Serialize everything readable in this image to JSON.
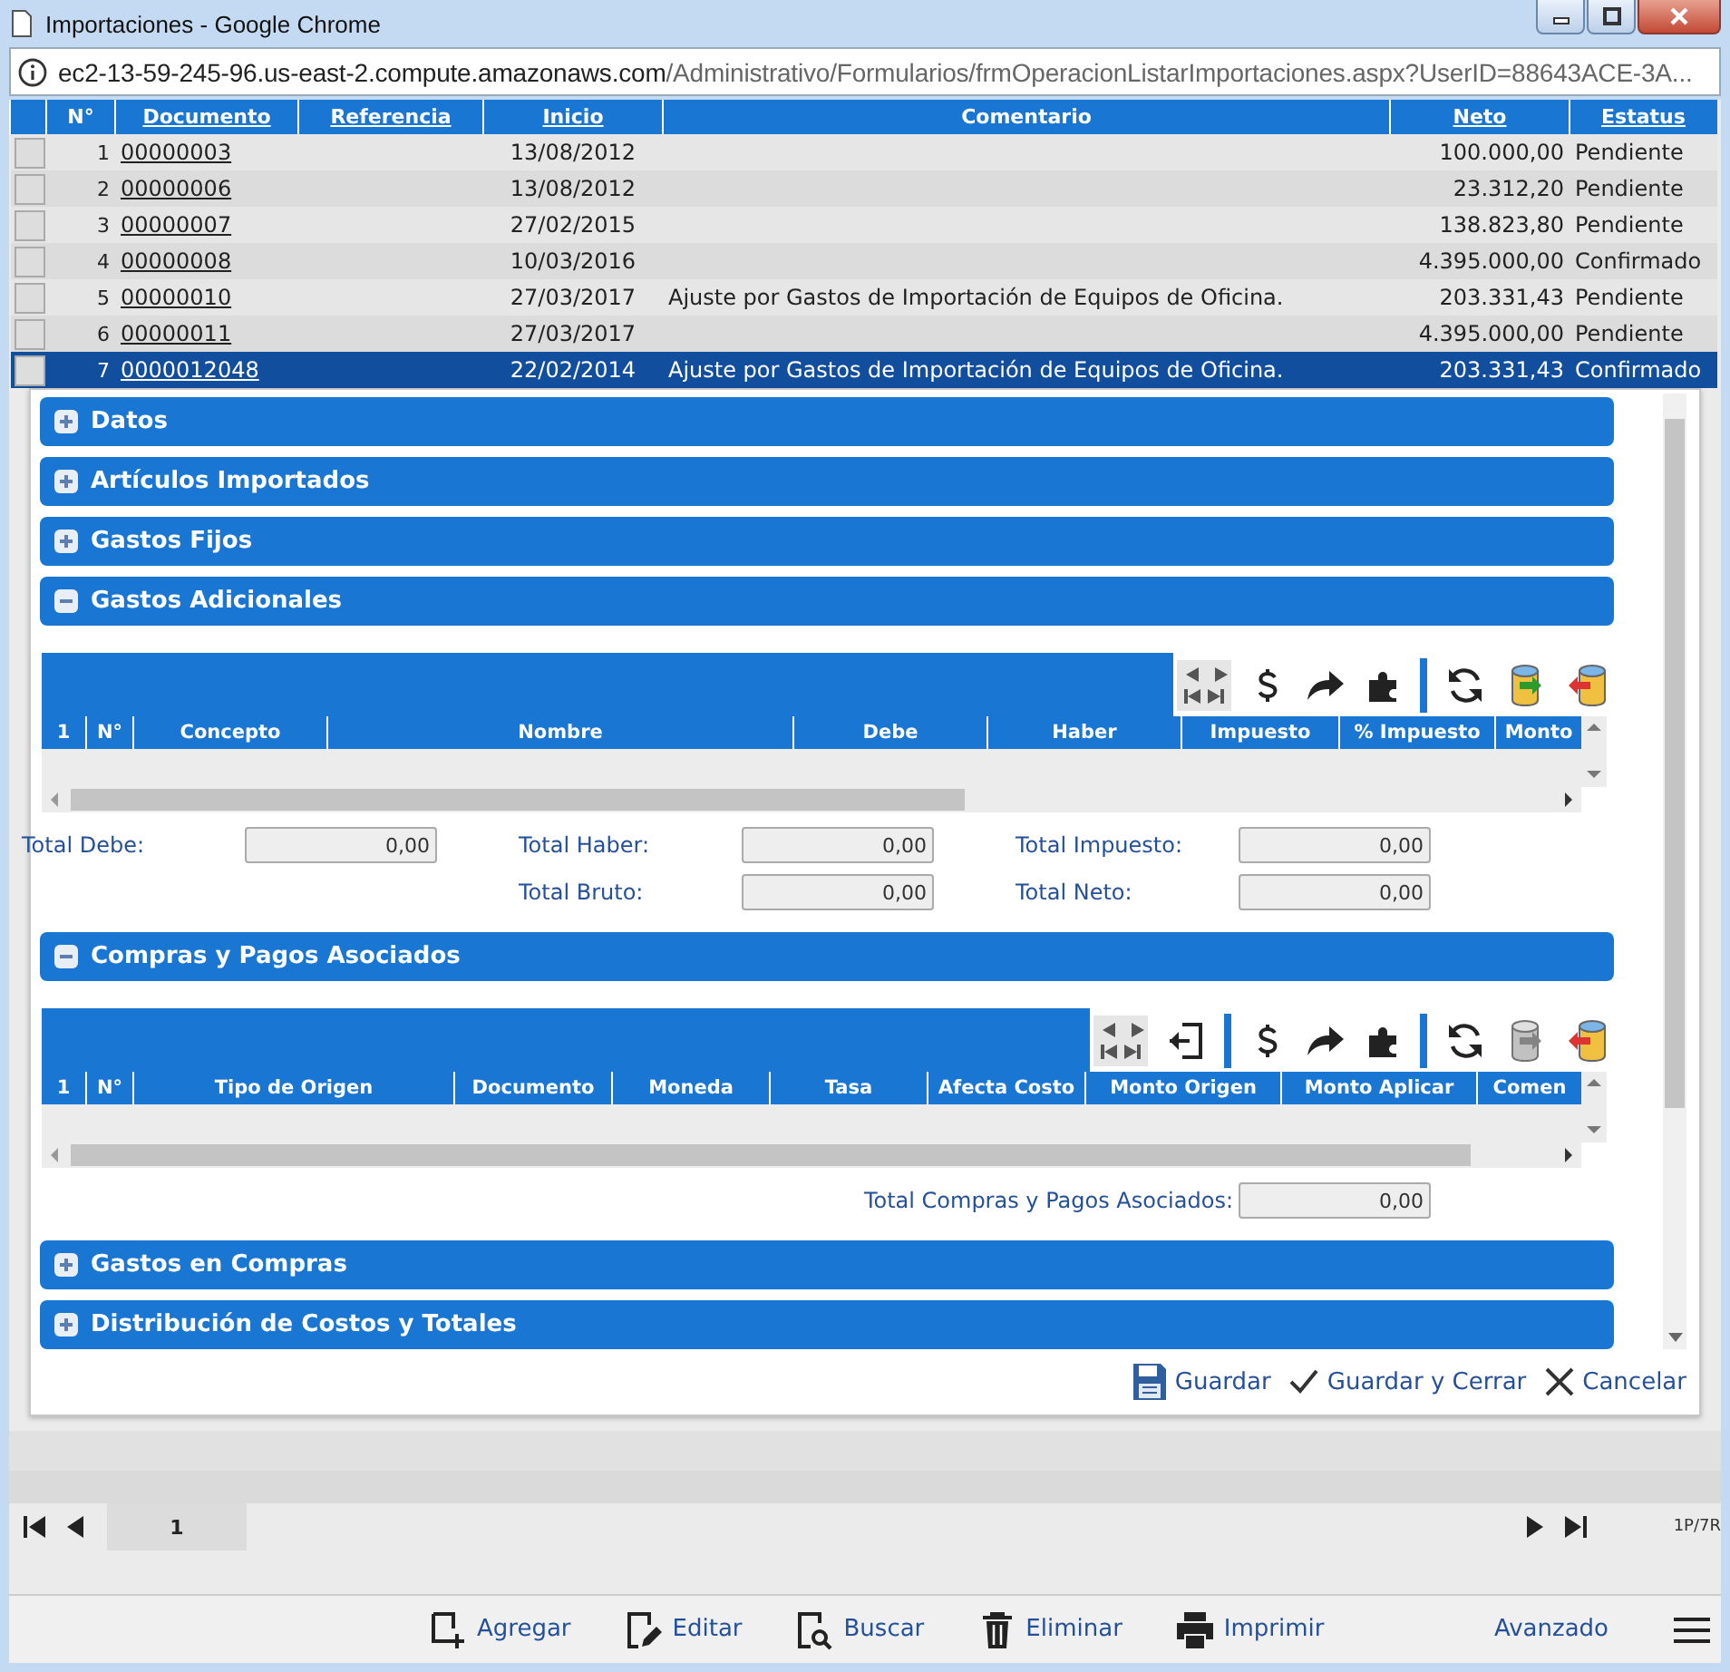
{
  "window": {
    "title": "Importaciones - Google Chrome"
  },
  "address_bar": {
    "host": "ec2-13-59-245-96.us-east-2.compute.amazonaws.com",
    "path": "/Administrativo/Formularios/frmOperacionListarImportaciones.aspx?UserID=88643ACE-3A..."
  },
  "list": {
    "columns": [
      {
        "label": "N°",
        "kind": "plain"
      },
      {
        "label": "Documento",
        "kind": "link"
      },
      {
        "label": "Referencia",
        "kind": "link"
      },
      {
        "label": "Inicio",
        "kind": "link"
      },
      {
        "label": "Comentario",
        "kind": "plain"
      },
      {
        "label": "Neto",
        "kind": "link"
      },
      {
        "label": "Estatus",
        "kind": "link"
      }
    ],
    "rows": [
      {
        "number": "1",
        "document": "00000003",
        "start": "13/08/2012",
        "net": "100.000,00",
        "status": "Pendiente",
        "selected": false
      },
      {
        "number": "2",
        "document": "00000006",
        "start": "13/08/2012",
        "net": "23.312,20",
        "status": "Pendiente",
        "selected": false
      },
      {
        "number": "3",
        "document": "00000007",
        "start": "27/02/2015",
        "net": "138.823,80",
        "status": "Pendiente",
        "selected": false
      },
      {
        "number": "4",
        "document": "00000008",
        "start": "10/03/2016",
        "net": "4.395.000,00",
        "status": "Confirmado",
        "selected": false
      },
      {
        "number": "5",
        "document": "00000010",
        "start": "27/03/2017",
        "comment": "Ajuste por Gastos de Importación de Equipos de Oficina.",
        "net": "203.331,43",
        "status": "Pendiente",
        "selected": false
      },
      {
        "number": "6",
        "document": "00000011",
        "start": "27/03/2017",
        "net": "4.395.000,00",
        "status": "Pendiente",
        "selected": false
      },
      {
        "number": "7",
        "document": "0000012048",
        "start": "22/02/2014",
        "comment": "Ajuste por Gastos de Importación de Equipos de Oficina.",
        "net": "203.331,43",
        "status": "Confirmado",
        "selected": true
      }
    ]
  },
  "dialog": {
    "sections": [
      {
        "title": "Datos",
        "expanded": false
      },
      {
        "title": "Artículos Importados",
        "expanded": false
      },
      {
        "title": "Gastos Fijos",
        "expanded": false
      },
      {
        "title": "Gastos Adicionales",
        "expanded": true,
        "grid": {
          "toolbar": [
            {
              "kind": "pager",
              "disabled": false
            },
            {
              "kind": "dollar",
              "disabled": false
            },
            {
              "kind": "share",
              "disabled": false
            },
            {
              "kind": "puzzle",
              "disabled": false
            },
            {
              "kind": "separator",
              "disabled": false
            },
            {
              "kind": "refresh",
              "disabled": false
            },
            {
              "kind": "db-in",
              "disabled": false
            },
            {
              "kind": "db-out",
              "disabled": false
            }
          ],
          "columns": [
            "1",
            "N°",
            "Concepto",
            "Nombre",
            "Debe",
            "Haber",
            "Impuesto",
            "% Impuesto",
            "Monto"
          ]
        },
        "totals": [
          {
            "fields": [
              {
                "label": "Total Debe:",
                "value": "0,00"
              },
              {
                "label": "Total Haber:",
                "value": "0,00"
              },
              {
                "label": "Total Impuesto:",
                "value": "0,00"
              }
            ]
          },
          {
            "fields": [
              {
                "label": "Total Bruto:",
                "value": "0,00"
              },
              {
                "label": "Total Neto:",
                "value": "0,00"
              }
            ]
          }
        ]
      },
      {
        "title": "Compras y Pagos Asociados",
        "expanded": true,
        "grid": {
          "toolbar": [
            {
              "kind": "pager",
              "disabled": false
            },
            {
              "kind": "import",
              "disabled": false
            },
            {
              "kind": "separator",
              "disabled": false
            },
            {
              "kind": "dollar",
              "disabled": false
            },
            {
              "kind": "share",
              "disabled": false
            },
            {
              "kind": "puzzle",
              "disabled": false
            },
            {
              "kind": "separator",
              "disabled": false
            },
            {
              "kind": "refresh",
              "disabled": false
            },
            {
              "kind": "db-in",
              "disabled": true
            },
            {
              "kind": "db-out",
              "disabled": false
            }
          ],
          "columns": [
            "1",
            "N°",
            "Tipo de Origen",
            "Documento",
            "Moneda",
            "Tasa",
            "Afecta Costo",
            "Monto Origen",
            "Monto Aplicar",
            "Comen"
          ]
        },
        "totals": [
          {
            "fields": [
              {
                "label": "Total Compras y Pagos Asociados:",
                "value": "0,00"
              }
            ]
          }
        ]
      },
      {
        "title": "Gastos en Compras",
        "expanded": false
      },
      {
        "title": "Distribución de Costos y Totales",
        "expanded": false
      }
    ],
    "footer": [
      {
        "kind": "save",
        "label": "Guardar"
      },
      {
        "kind": "save-close",
        "label": "Guardar y Cerrar"
      },
      {
        "kind": "cancel",
        "label": "Cancelar"
      }
    ]
  },
  "pager": {
    "page": "1",
    "summary": "1P/7R"
  },
  "toolbar": {
    "actions": [
      {
        "kind": "add",
        "label": "Agregar"
      },
      {
        "kind": "edit",
        "label": "Editar"
      },
      {
        "kind": "search",
        "label": "Buscar"
      },
      {
        "kind": "delete",
        "label": "Eliminar"
      },
      {
        "kind": "print",
        "label": "Imprimir"
      }
    ],
    "advanced": "Avanzado"
  }
}
